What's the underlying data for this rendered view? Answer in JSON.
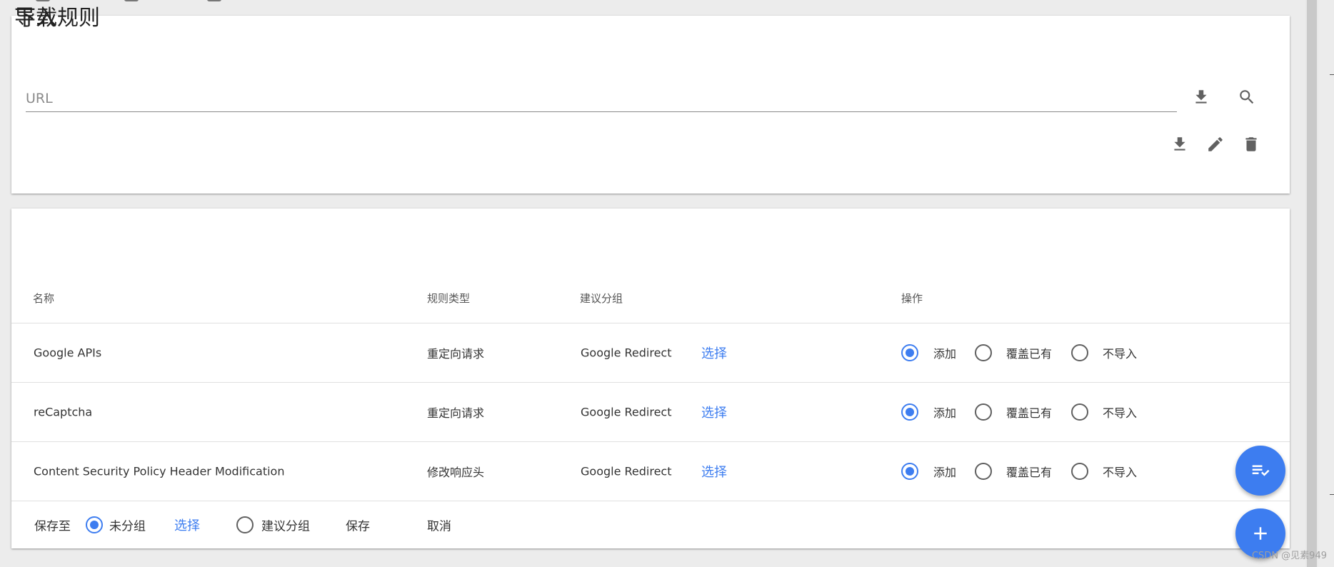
{
  "rules_card": {
    "title": "下载规则",
    "url_placeholder": "URL",
    "icons": {
      "download": "download-icon",
      "search": "search-icon",
      "edit": "edit-icon",
      "delete": "delete-icon"
    }
  },
  "import_card": {
    "title": "导入",
    "columns": [
      "名称",
      "规则类型",
      "建议分组",
      "操作"
    ],
    "rows": [
      {
        "name": "Google APIs",
        "type": "重定向请求",
        "group": "Google Redirect",
        "select": "选择",
        "action": "添加"
      },
      {
        "name": "reCaptcha",
        "type": "重定向请求",
        "group": "Google Redirect",
        "select": "选择",
        "action": "添加"
      },
      {
        "name": "Content Security Policy Header Modification",
        "type": "修改响应头",
        "group": "Google Redirect",
        "select": "选择",
        "action": "添加"
      }
    ],
    "options": [
      "添加",
      "覆盖已有",
      "不导入"
    ],
    "footer": {
      "save_to": "保存至",
      "ungrouped": "未分组",
      "select": "选择",
      "suggested": "建议分组",
      "save": "保存",
      "cancel": "取消",
      "selected_target": "未分组"
    }
  },
  "fabs": {
    "batch": "playlist-check-icon",
    "add": "plus-icon"
  },
  "watermark": "CSDN @见素949",
  "colors": {
    "accent": "#3d7df0",
    "icon": "#616161",
    "background": "#ececec"
  }
}
